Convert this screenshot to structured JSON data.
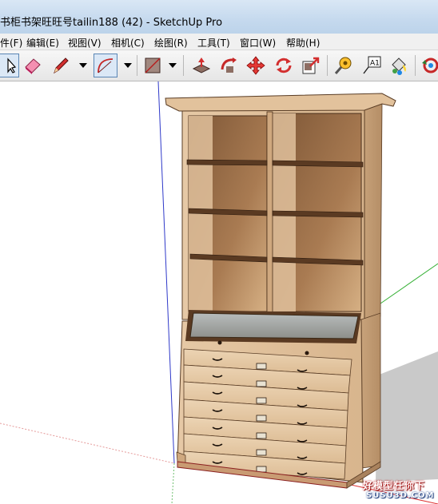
{
  "window": {
    "title": "书柜书架旺旺号tailin188 (42) - SketchUp Pro"
  },
  "menu": {
    "items": [
      "件(F)",
      "编辑(E)",
      "视图(V)",
      "相机(C)",
      "绘图(R)",
      "工具(T)",
      "窗口(W)",
      "帮助(H)"
    ]
  },
  "toolbar": {
    "tools": [
      "select-icon",
      "eraser-icon",
      "pencil-icon",
      "arc-icon",
      "rectangle-icon",
      "push-pull-icon",
      "follow-me-icon",
      "move-icon",
      "rotate-icon",
      "scale-icon",
      "tape-measure-icon",
      "text-label-icon",
      "paint-bucket-icon",
      "orbit-icon"
    ],
    "text_tool_glyph": "A1"
  },
  "model": {
    "name": "bookcase-cabinet",
    "drawer_count": 7
  },
  "watermark": {
    "cn": "好模型任你下",
    "en": "SUSU3D.COM"
  }
}
